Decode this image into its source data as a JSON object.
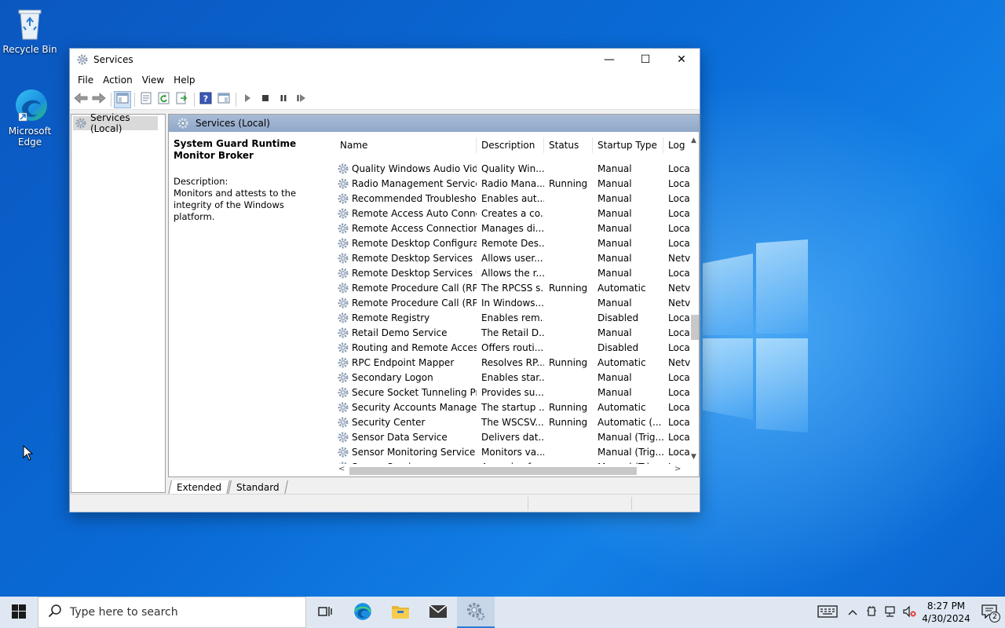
{
  "desktop": {
    "icons": [
      {
        "label": "Recycle Bin"
      },
      {
        "label": "Microsoft Edge"
      }
    ]
  },
  "window": {
    "title": "Services",
    "controls": {
      "minimize": "—",
      "maximize": "☐",
      "close": "✕"
    },
    "menu": [
      "File",
      "Action",
      "View",
      "Help"
    ],
    "tree": {
      "root": "Services (Local)"
    },
    "header": "Services (Local)",
    "selected_service": {
      "name": "System Guard Runtime Monitor Broker",
      "description_label": "Description:",
      "description": "Monitors and attests to the integrity of the Windows platform."
    },
    "columns": [
      "Name",
      "Description",
      "Status",
      "Startup Type",
      "Log"
    ],
    "rows": [
      {
        "name": "Quality Windows Audio Vid...",
        "description": "Quality Win...",
        "status": "",
        "startup": "Manual",
        "log": "Loca"
      },
      {
        "name": "Radio Management Service",
        "description": "Radio Mana...",
        "status": "Running",
        "startup": "Manual",
        "log": "Loca"
      },
      {
        "name": "Recommended Troublesho...",
        "description": "Enables aut...",
        "status": "",
        "startup": "Manual",
        "log": "Loca"
      },
      {
        "name": "Remote Access Auto Conne...",
        "description": "Creates a co...",
        "status": "",
        "startup": "Manual",
        "log": "Loca"
      },
      {
        "name": "Remote Access Connection...",
        "description": "Manages di...",
        "status": "",
        "startup": "Manual",
        "log": "Loca"
      },
      {
        "name": "Remote Desktop Configurat...",
        "description": "Remote Des...",
        "status": "",
        "startup": "Manual",
        "log": "Loca"
      },
      {
        "name": "Remote Desktop Services",
        "description": "Allows user...",
        "status": "",
        "startup": "Manual",
        "log": "Netv"
      },
      {
        "name": "Remote Desktop Services U...",
        "description": "Allows the r...",
        "status": "",
        "startup": "Manual",
        "log": "Loca"
      },
      {
        "name": "Remote Procedure Call (RPC)",
        "description": "The RPCSS s...",
        "status": "Running",
        "startup": "Automatic",
        "log": "Netv"
      },
      {
        "name": "Remote Procedure Call (RP...",
        "description": "In Windows...",
        "status": "",
        "startup": "Manual",
        "log": "Netv"
      },
      {
        "name": "Remote Registry",
        "description": "Enables rem...",
        "status": "",
        "startup": "Disabled",
        "log": "Loca"
      },
      {
        "name": "Retail Demo Service",
        "description": "The Retail D...",
        "status": "",
        "startup": "Manual",
        "log": "Loca"
      },
      {
        "name": "Routing and Remote Access",
        "description": "Offers routi...",
        "status": "",
        "startup": "Disabled",
        "log": "Loca"
      },
      {
        "name": "RPC Endpoint Mapper",
        "description": "Resolves RP...",
        "status": "Running",
        "startup": "Automatic",
        "log": "Netv"
      },
      {
        "name": "Secondary Logon",
        "description": "Enables star...",
        "status": "",
        "startup": "Manual",
        "log": "Loca"
      },
      {
        "name": "Secure Socket Tunneling Pr...",
        "description": "Provides su...",
        "status": "",
        "startup": "Manual",
        "log": "Loca"
      },
      {
        "name": "Security Accounts Manager",
        "description": "The startup ...",
        "status": "Running",
        "startup": "Automatic",
        "log": "Loca"
      },
      {
        "name": "Security Center",
        "description": "The WSCSV...",
        "status": "Running",
        "startup": "Automatic (...",
        "log": "Loca"
      },
      {
        "name": "Sensor Data Service",
        "description": "Delivers dat...",
        "status": "",
        "startup": "Manual (Trig...",
        "log": "Loca"
      },
      {
        "name": "Sensor Monitoring Service",
        "description": "Monitors va...",
        "status": "",
        "startup": "Manual (Trig...",
        "log": "Loca"
      },
      {
        "name": "Sensor Service",
        "description": "A service fo...",
        "status": "",
        "startup": "Manual (Trig...",
        "log": "Loca"
      }
    ],
    "tabs": [
      "Extended",
      "Standard"
    ]
  },
  "taskbar": {
    "search_placeholder": "Type here to search",
    "time": "8:27 PM",
    "date": "4/30/2024",
    "notification_count": "2"
  },
  "colors": {
    "header_bar": "#9db3d2",
    "accent": "#2b7bd6",
    "desktop": "#0a63cf"
  }
}
